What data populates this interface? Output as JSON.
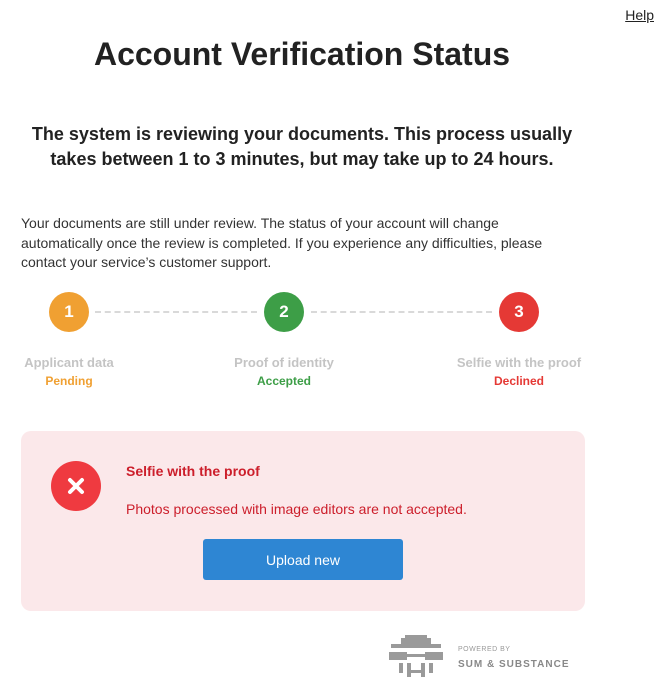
{
  "header": {
    "help_link": "Help",
    "title": "Account Verification Status"
  },
  "subtitle": "The system is reviewing your documents. This process usually takes between 1 to 3 minutes, but may take up to 24 hours.",
  "description": "Your documents are still under review. The status of your account will change automatically once the review is completed. If you experience any difficulties, please contact your service’s customer support.",
  "steps": [
    {
      "number": "1",
      "label": "Applicant data",
      "status": "Pending",
      "color": "#f0a032"
    },
    {
      "number": "2",
      "label": "Proof of identity",
      "status": "Accepted",
      "color": "#3d9e47"
    },
    {
      "number": "3",
      "label": "Selfie with the proof",
      "status": "Declined",
      "color": "#e53935"
    }
  ],
  "alert": {
    "icon": "close-icon",
    "title": "Selfie with the proof",
    "message": "Photos processed with image editors are not accepted.",
    "button_label": "Upload new",
    "background": "#fbe8ea",
    "text_color": "#cc1e2b",
    "button_color": "#2e86d3"
  },
  "footer": {
    "powered_by": "POWERED BY",
    "brand": "SUM & SUBSTANCE"
  }
}
